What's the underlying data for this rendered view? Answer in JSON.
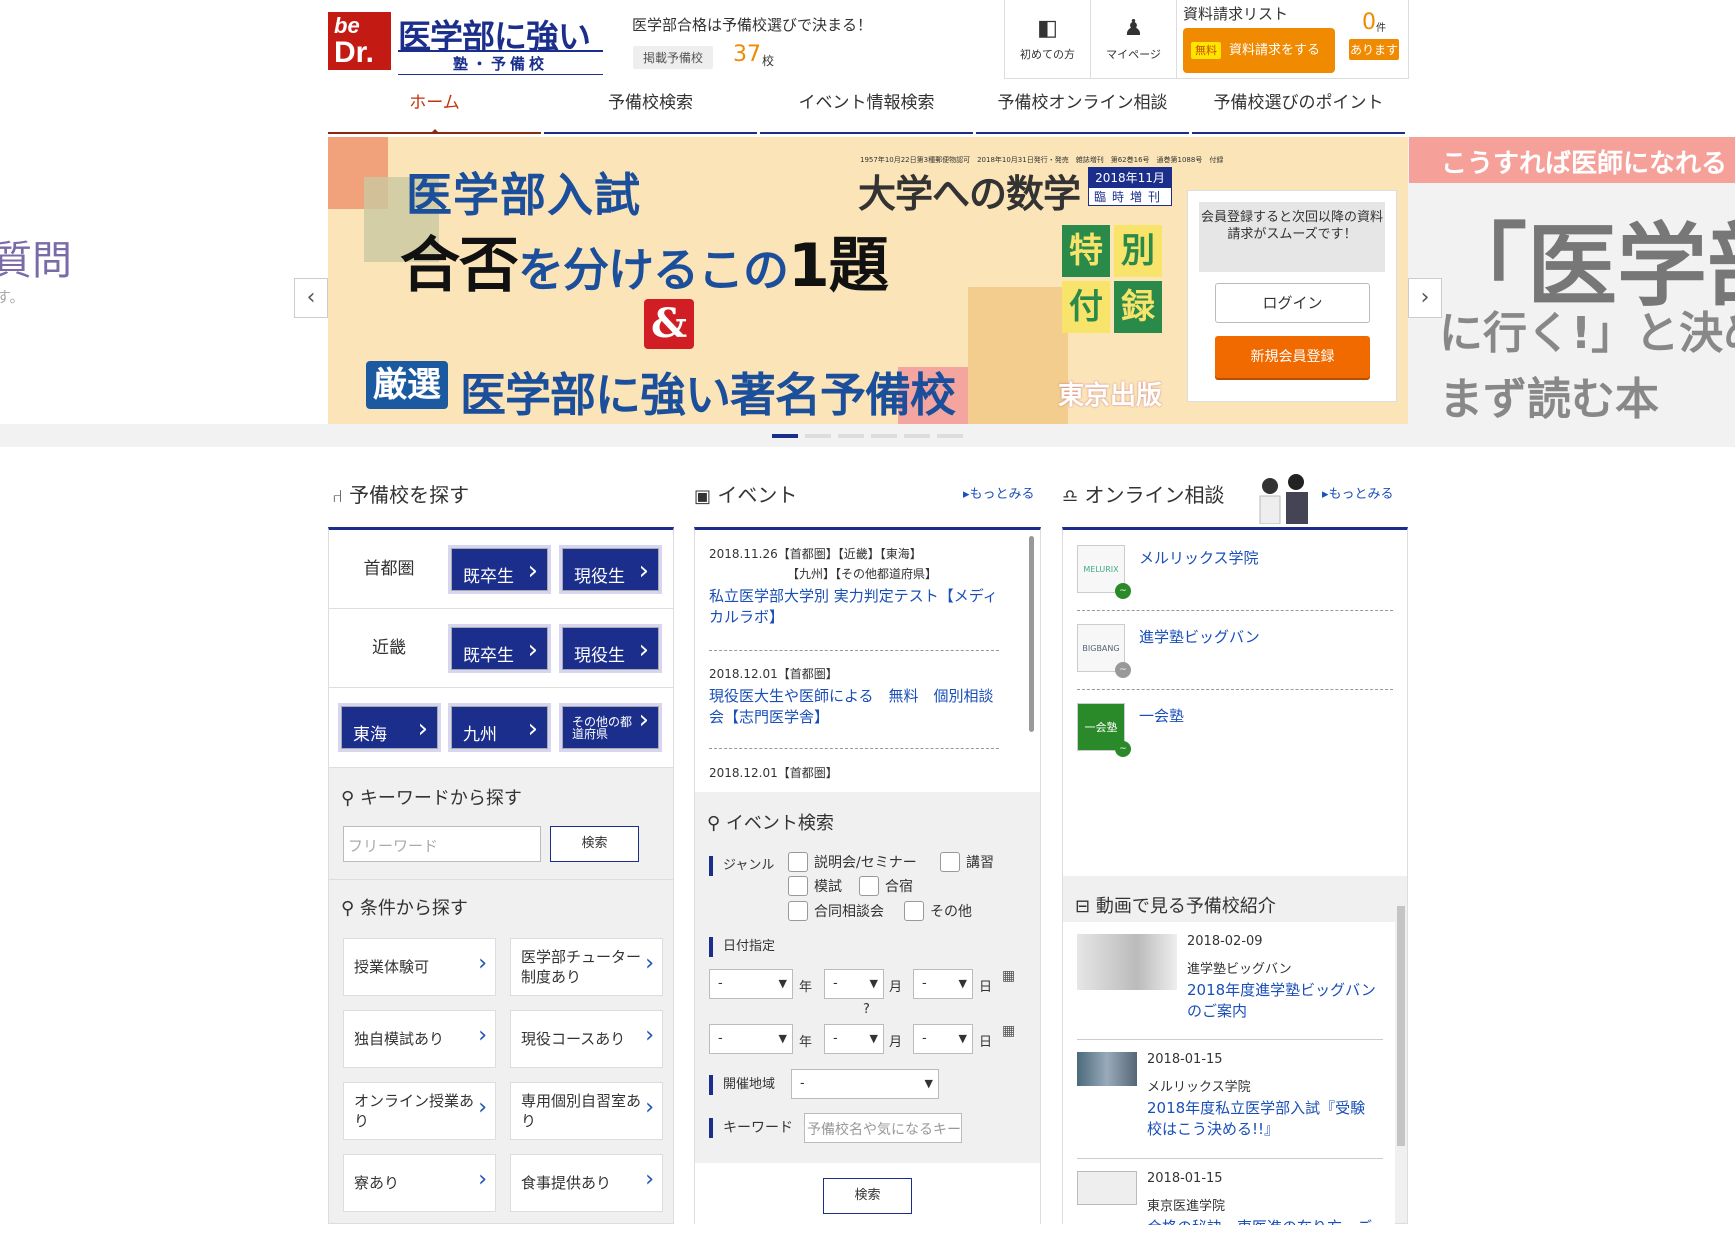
{
  "header": {
    "logo": {
      "be": "be",
      "dr": "Dr.",
      "title": "医学部に強い",
      "subtitle": "塾・予備校"
    },
    "tagline": "医学部合格は予備校選びで決まる！",
    "count_label": "掲載予備校",
    "count_num": "37",
    "count_unit": "校",
    "first_visit": "初めての方",
    "mypage": "マイページ",
    "request_title": "資料請求リスト",
    "request_free": "無料",
    "request_button": "資料請求をする",
    "request_count": "0",
    "request_count_unit": "件",
    "request_count_note": "あります"
  },
  "nav": {
    "items": [
      "ホーム",
      "予備校検索",
      "イベント情報検索",
      "予備校オンライン相談",
      "予備校選びのポイント"
    ],
    "active": 0
  },
  "hero": {
    "left_text": "質問",
    "left_sub": "す。",
    "headline1": "医学部入試",
    "headline2a": "合否",
    "headline2b": "を分けるこの",
    "headline2c": "1題",
    "amp": "&",
    "badge": "厳選",
    "headline3": "医学部に強い著名予備校",
    "mag_small": "1957年10月22日第3種郵便物認可　2018年10月31日発行・発売　雑誌増刊　第62巻16号　通巻第1088号　付録",
    "mag_title": "大学への数学",
    "mag_date": "2018年11月",
    "mag_extra": "臨時増刊",
    "toku": [
      "特",
      "別",
      "付",
      "録"
    ],
    "publisher": "東京出版",
    "login_message": "会員登録すると次回以降の資料請求がスムーズです！",
    "login_button": "ログイン",
    "signup_button": "新規会員登録",
    "right_bar": "こうすれば医師になれる",
    "right_big1": "「医学部",
    "right_big2": "に行く!」と決め",
    "right_big3": "まず読む本",
    "prev": "‹",
    "next": "›"
  },
  "search_col": {
    "title": "予備校を探す",
    "regions": [
      {
        "name": "首都圏",
        "b1": "既卒生",
        "b2": "現役生"
      },
      {
        "name": "近畿",
        "b1": "既卒生",
        "b2": "現役生"
      }
    ],
    "regions2": [
      "東海",
      "九州",
      "その他の都道府県"
    ],
    "keyword_title": "キーワードから探す",
    "keyword_placeholder": "フリーワード",
    "keyword_button": "検索",
    "cond_title": "条件から探す",
    "conditions": [
      "授業体験可",
      "医学部チューター制度あり",
      "独自模試あり",
      "現役コースあり",
      "オンライン授業あり",
      "専用個別自習室あり",
      "寮あり",
      "食事提供あり"
    ]
  },
  "event_col": {
    "title": "イベント",
    "more": "もっとみる",
    "events": [
      {
        "meta": "2018.11.26【首都圏】【近畿】【東海】",
        "meta2": "【九州】【その他都道府県】",
        "title": "私立医学部大学別 実力判定テスト【メディカルラボ】"
      },
      {
        "meta": "2018.12.01【首都圏】",
        "meta2": "",
        "title": "現役医大生や医師による　無料　個別相談会【志門医学舎】"
      },
      {
        "meta": "2018.12.01【首都圏】",
        "meta2": "",
        "title": ""
      }
    ],
    "search_title": "イベント検索",
    "genre_label": "ジャンル",
    "genres": [
      "説明会/セミナー",
      "講習",
      "模試",
      "合宿",
      "合同相談会",
      "その他"
    ],
    "date_label": "日付指定",
    "year": "年",
    "month": "月",
    "day": "日",
    "dash": "-",
    "tilde": "?",
    "area_label": "開催地域",
    "keyword_label": "キーワード",
    "keyword_placeholder": "予備校名や気になるキーワード",
    "search_button": "検索"
  },
  "online_col": {
    "title": "オンライン相談",
    "more": "もっとみる",
    "schools": [
      {
        "name": "メルリックス学院",
        "logo": "MELURIX",
        "status": "online"
      },
      {
        "name": "進学塾ビッグバン",
        "logo": "BIGBANG",
        "status": "offline"
      },
      {
        "name": "一会塾",
        "logo": "一会塾",
        "status": "online"
      }
    ],
    "video_title": "動画で見る予備校紹介",
    "videos": [
      {
        "date": "2018-02-09",
        "school": "進学塾ビッグバン",
        "title": "2018年度進学塾ビッグバンのご案内"
      },
      {
        "date": "2018-01-15",
        "school": "メルリックス学院",
        "title": "2018年度私立医学部入試『受験校はこう決める!!』"
      },
      {
        "date": "2018-01-15",
        "school": "東京医進学院",
        "title": "合格の秘訣　東医進の在り方　ご"
      }
    ]
  },
  "colors": {
    "brand": "#1b2e8c",
    "accent": "#f08a00",
    "link": "#1a4fb8"
  }
}
